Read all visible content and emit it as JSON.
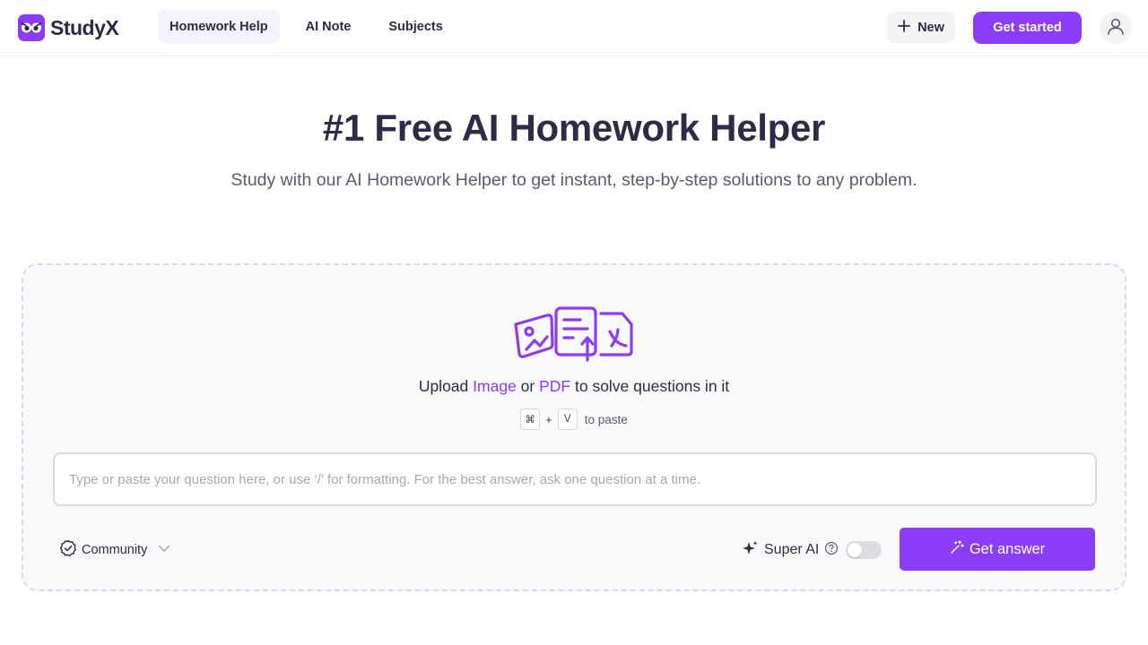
{
  "header": {
    "logo_text": "StudyX",
    "nav": [
      {
        "label": "Homework Help",
        "active": true
      },
      {
        "label": "AI Note",
        "active": false
      },
      {
        "label": "Subjects",
        "active": false
      }
    ],
    "new_label": "New",
    "get_started_label": "Get started"
  },
  "hero": {
    "title": "#1 Free AI Homework Helper",
    "subtitle": "Study with our AI Homework Helper to get instant, step-by-step solutions to any problem."
  },
  "upload": {
    "prefix": "Upload",
    "image_link": "Image",
    "or": "or",
    "pdf_link": "PDF",
    "suffix": "to solve questions in it",
    "key1": "⌘",
    "plus": "+",
    "key2": "V",
    "paste_label": "to paste"
  },
  "question": {
    "placeholder": "Type or paste your question here, or use ‘/’ for formatting. For the best answer, ask one question at a time.",
    "value": ""
  },
  "controls": {
    "community_label": "Community",
    "super_ai_label": "Super AI",
    "super_ai_enabled": false,
    "get_answer_label": "Get answer"
  },
  "colors": {
    "accent": "#8b3cf7",
    "text": "#2d2b45",
    "muted": "#5c5a72"
  },
  "icons": {
    "logo": "owl-eyes-icon",
    "new": "plus-icon",
    "avatar": "user-icon",
    "upload": "upload-files-icon",
    "community": "check-badge-icon",
    "dropdown": "chevron-down-icon",
    "super_ai": "sparkle-icon",
    "help": "question-circle-icon",
    "answer": "magic-wand-icon"
  }
}
